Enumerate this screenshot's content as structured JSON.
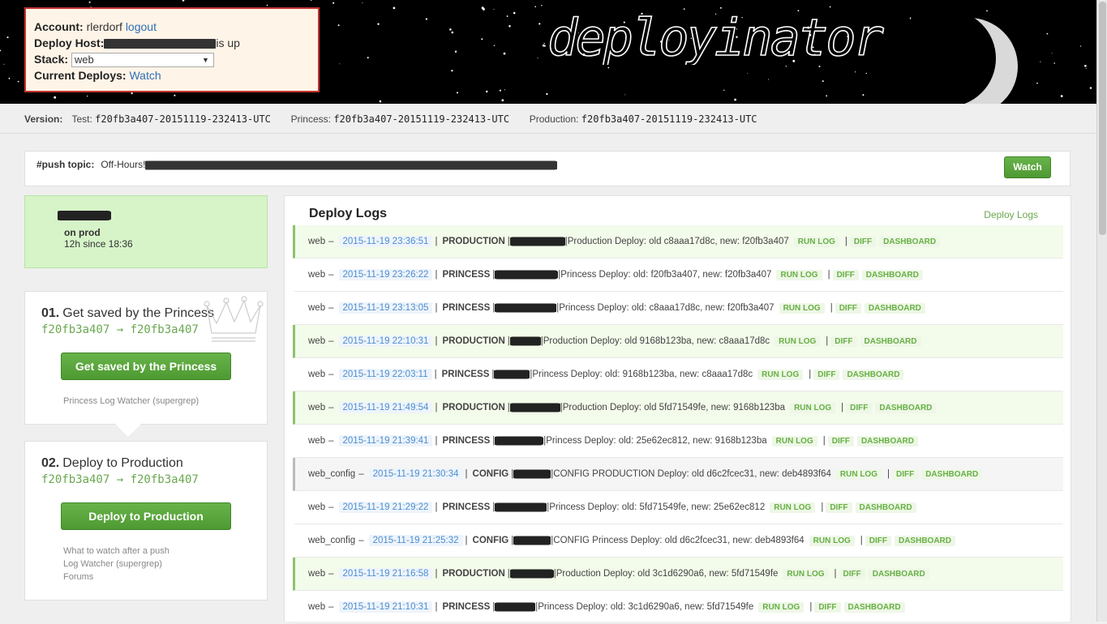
{
  "account": {
    "account_label": "Account:",
    "username": "rlerdorf",
    "logout": "logout",
    "deploy_host_label": "Deploy Host:",
    "deploy_host_status": "is up",
    "stack_label": "Stack:",
    "stack_value": "web",
    "current_deploys_label": "Current Deploys:",
    "current_deploys_link": "Watch"
  },
  "versions": {
    "label": "Version:",
    "test_label": "Test:",
    "test": "f20fb3a407-20151119-232413-UTC",
    "princess_label": "Princess:",
    "princess": "f20fb3a407-20151119-232413-UTC",
    "production_label": "Production:",
    "production": "f20fb3a407-20151119-232413-UTC"
  },
  "push_topic": {
    "label": "#push topic:",
    "text": "Off-Hours!",
    "watch_button": "Watch"
  },
  "status": {
    "location": "on prod",
    "since": "12h since 18:36"
  },
  "steps": [
    {
      "number": "01.",
      "title": "Get saved by the Princess",
      "commit": "f20fb3a407 → f20fb3a407",
      "button": "Get saved by the Princess",
      "links": [
        "Princess Log Watcher (supergrep)"
      ]
    },
    {
      "number": "02.",
      "title": "Deploy to Production",
      "commit": "f20fb3a407 → f20fb3a407",
      "button": "Deploy to Production",
      "links": [
        "What to watch after a push",
        "Log Watcher (supergrep)",
        "Forums"
      ]
    }
  ],
  "logs": {
    "title": "Deploy Logs",
    "link": "Deploy Logs",
    "run_log": "RUN LOG",
    "diff": "DIFF",
    "dashboard": "DASHBOARD",
    "rows": [
      {
        "stack": "web",
        "ts": "2015-11-19 23:36:51",
        "stage": "PRODUCTION",
        "msg": "Production Deploy: old c8aaa17d8c, new: f20fb3a407",
        "kind": "prod"
      },
      {
        "stack": "web",
        "ts": "2015-11-19 23:26:22",
        "stage": "PRINCESS",
        "msg": "Princess Deploy: old: f20fb3a407, new: f20fb3a407",
        "kind": "normal"
      },
      {
        "stack": "web",
        "ts": "2015-11-19 23:13:05",
        "stage": "PRINCESS",
        "msg": "Princess Deploy: old: c8aaa17d8c, new: f20fb3a407",
        "kind": "normal"
      },
      {
        "stack": "web",
        "ts": "2015-11-19 22:10:31",
        "stage": "PRODUCTION",
        "msg": "Production Deploy: old 9168b123ba, new: c8aaa17d8c",
        "kind": "prod"
      },
      {
        "stack": "web",
        "ts": "2015-11-19 22:03:11",
        "stage": "PRINCESS",
        "msg": "Princess Deploy: old: 9168b123ba, new: c8aaa17d8c",
        "kind": "normal"
      },
      {
        "stack": "web",
        "ts": "2015-11-19 21:49:54",
        "stage": "PRODUCTION",
        "msg": "Production Deploy: old 5fd71549fe, new: 9168b123ba",
        "kind": "prod"
      },
      {
        "stack": "web",
        "ts": "2015-11-19 21:39:41",
        "stage": "PRINCESS",
        "msg": "Princess Deploy: old: 25e62ec812, new: 9168b123ba",
        "kind": "normal"
      },
      {
        "stack": "web_config",
        "ts": "2015-11-19 21:30:34",
        "stage": "CONFIG",
        "msg": "CONFIG PRODUCTION Deploy: old d6c2fcec31, new: deb4893f64",
        "kind": "config"
      },
      {
        "stack": "web",
        "ts": "2015-11-19 21:29:22",
        "stage": "PRINCESS",
        "msg": "Princess Deploy: old: 5fd71549fe, new: 25e62ec812",
        "kind": "normal"
      },
      {
        "stack": "web_config",
        "ts": "2015-11-19 21:25:32",
        "stage": "CONFIG",
        "msg": "CONFIG Princess Deploy: old d6c2fcec31, new: deb4893f64",
        "kind": "normal"
      },
      {
        "stack": "web",
        "ts": "2015-11-19 21:16:58",
        "stage": "PRODUCTION",
        "msg": "Production Deploy: old 3c1d6290a6, new: 5fd71549fe",
        "kind": "prod"
      },
      {
        "stack": "web",
        "ts": "2015-11-19 21:10:31",
        "stage": "PRINCESS",
        "msg": "Princess Deploy: old: 3c1d6290a6, new: 5fd71549fe",
        "kind": "normal"
      }
    ]
  }
}
